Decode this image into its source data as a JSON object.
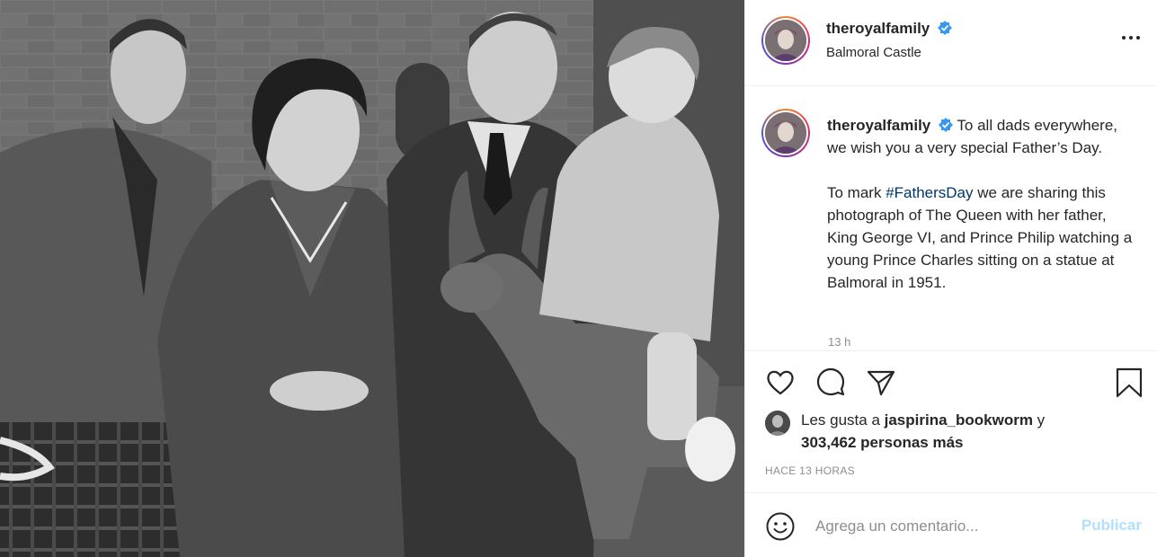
{
  "post": {
    "username": "theroyalfamily",
    "location": "Balmoral Castle",
    "photo_description_icon": "photo-icon"
  },
  "caption": {
    "username": "theroyalfamily",
    "line1": "To all dads everywhere, we wish you a very special Father’s Day.",
    "p2_before": "To mark ",
    "hashtag": "#FathersDay",
    "p2_after": " we are sharing this photograph of The Queen with her father, King George VI, and Prince Philip watching a young Prince Charles sitting on a statue at Balmoral in 1951.",
    "time": "13 h"
  },
  "likes": {
    "prefix": "Les gusta a ",
    "liker": "jaspirina_bookworm",
    "suffix": " y",
    "count_text": "303,462 personas más"
  },
  "date": "HACE 13 HORAS",
  "comment": {
    "placeholder": "Agrega un comentario...",
    "publish_label": "Publicar"
  },
  "colors": {
    "verified": "#3897f0",
    "link": "#00376b",
    "publish_disabled": "#b2dffc",
    "muted": "#8e8e8e"
  }
}
